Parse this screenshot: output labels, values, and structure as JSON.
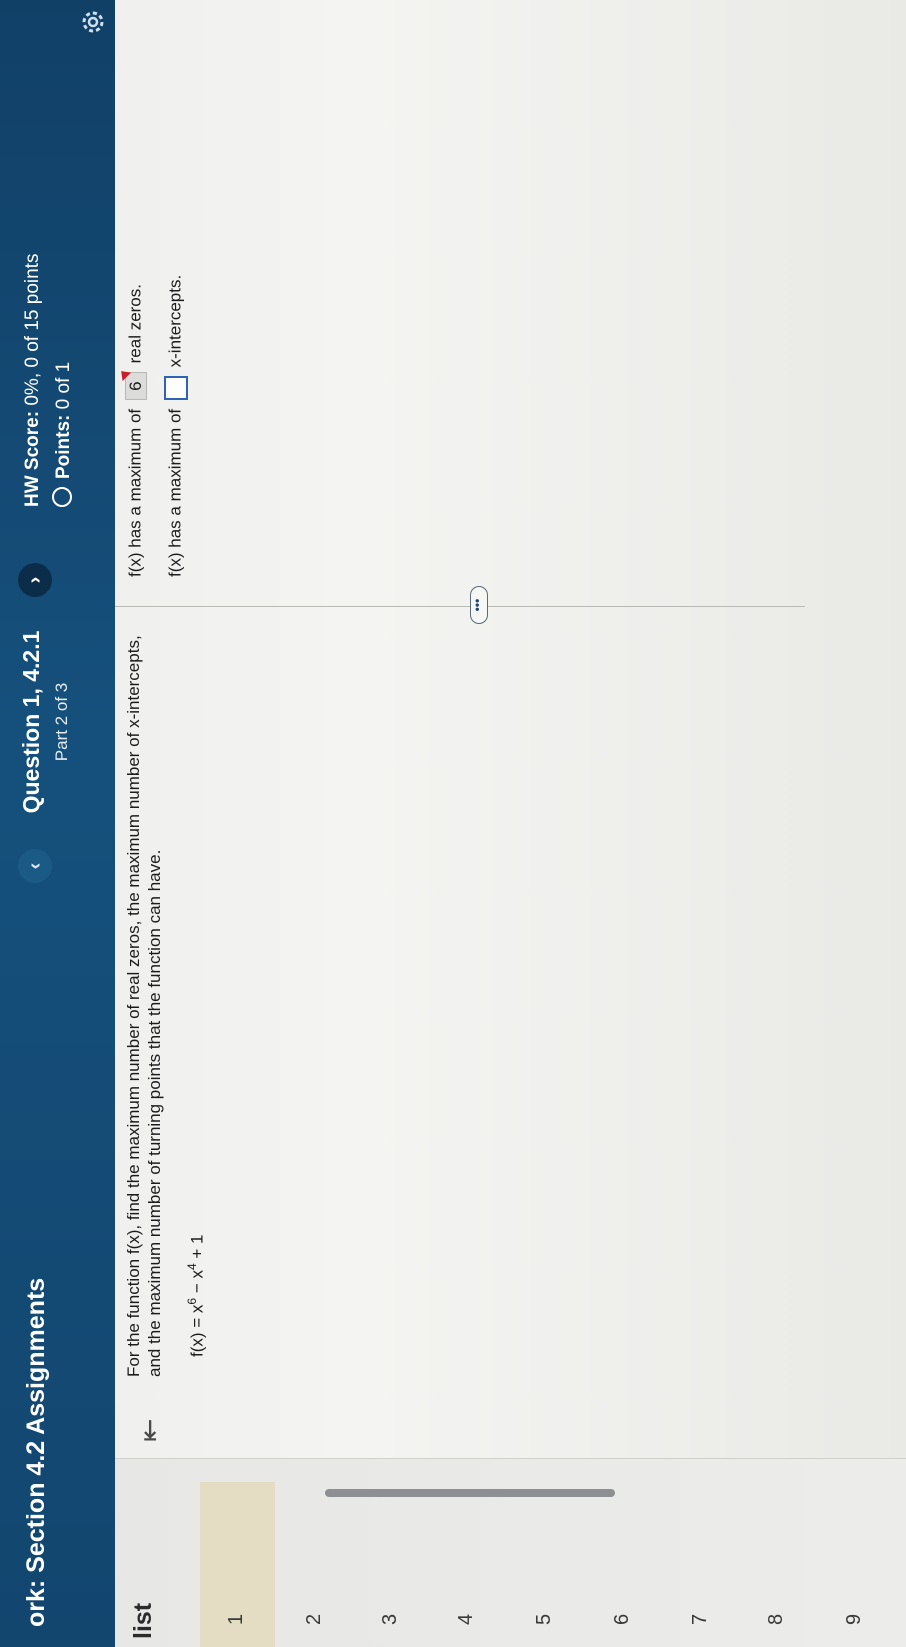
{
  "header": {
    "assignment_title": "ork: Section 4.2 Assignments",
    "question_title": "Question 1, 4.2.1",
    "question_part": "Part 2 of 3",
    "prev_icon": "chevron-left-icon",
    "next_icon": "chevron-right-icon",
    "hw_score_label": "HW Score:",
    "hw_score_value": "0%, 0 of 15 points",
    "points_label": "Points:",
    "points_value": "0 of 1",
    "settings_icon": "gear-icon"
  },
  "sidebar": {
    "label": "list",
    "numbers": [
      "1",
      "2",
      "3",
      "4",
      "5",
      "6",
      "7",
      "8",
      "9"
    ]
  },
  "question": {
    "prompt": "For the function f(x), find the maximum number of real zeros, the maximum number of x-intercepts, and the maximum number of turning points that the function can have.",
    "func_prefix": "f(x) = x",
    "exp1": "6",
    "func_mid": " − x",
    "exp2": "4",
    "func_suffix": " + 1",
    "more_label": "•••"
  },
  "answers": {
    "line1_prefix": "f(x) has a maximum of",
    "line1_value": "6",
    "line1_suffix": "real zeros.",
    "line2_prefix": "f(x) has a maximum of",
    "line2_value": "",
    "line2_suffix": "x-intercepts."
  },
  "colors": {
    "header_bg": "#15507c",
    "input_border": "#2e64b2",
    "incorrect_flag": "#c8202a"
  }
}
